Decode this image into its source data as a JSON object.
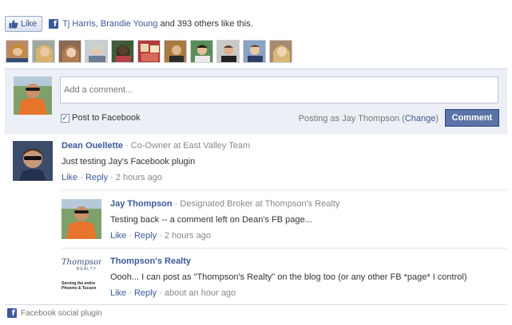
{
  "like_bar": {
    "like_button_label": "Like",
    "friends_text": "Tj Harris, Brandie Young",
    "others_text": " and 393 others like this."
  },
  "faces": [
    {
      "name": "face-1"
    },
    {
      "name": "face-2"
    },
    {
      "name": "face-3"
    },
    {
      "name": "face-4"
    },
    {
      "name": "face-5"
    },
    {
      "name": "face-6"
    },
    {
      "name": "face-7"
    },
    {
      "name": "face-8"
    },
    {
      "name": "face-9"
    },
    {
      "name": "face-10"
    },
    {
      "name": "face-11"
    }
  ],
  "composer": {
    "placeholder": "Add a comment...",
    "post_to_label": "Post to Facebook",
    "posting_as_prefix": "Posting as Jay Thompson (",
    "change_label": "Change",
    "posting_as_suffix": ")",
    "comment_button_label": "Comment"
  },
  "comments": [
    {
      "name": "Dean Ouellette",
      "role": " · Co-Owner at East Valley Team",
      "text": "Just testing Jay's Facebook plugin",
      "like": "Like",
      "reply": "Reply",
      "time": " · 2 hours ago"
    },
    {
      "name": "Jay Thompson",
      "role": " · Designated Broker at Thompson's Realty",
      "text": "Testing back -- a comment left on Dean's FB page...",
      "like": "Like",
      "reply": "Reply",
      "time": " · 2 hours ago"
    },
    {
      "name": "Thompson's Realty",
      "role": "",
      "text": "Oooh... I can post as \"Thompson's Realty\" on the blog too (or any other FB *page* I control)",
      "like": "Like",
      "reply": "Reply",
      "time": " · about an hour ago"
    }
  ],
  "logo": {
    "brand": "Thompson's",
    "sub": "REALTY",
    "line1": "Serving the entire",
    "line2": "Phoenix & Tucson"
  },
  "footer": {
    "label": "Facebook social plugin"
  },
  "colors": {
    "link": "#3b5998",
    "composer_bg": "#eceff5",
    "button_bg": "#5b74a8"
  }
}
